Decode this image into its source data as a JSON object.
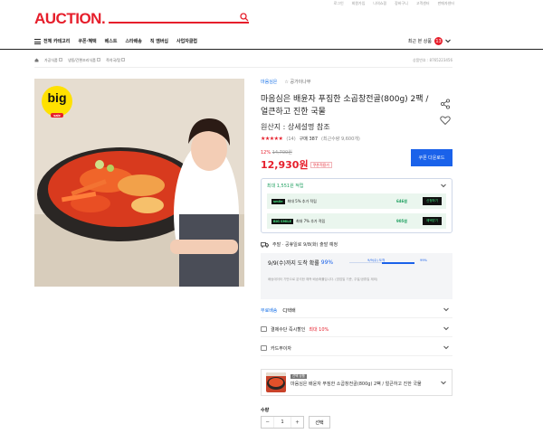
{
  "util": [
    "로그인",
    "회원가입",
    "나의쇼핑",
    "장바구니",
    "고객센터",
    "판매자센터"
  ],
  "logo": "AUCTION.",
  "search": {
    "placeholder": ""
  },
  "nav": {
    "all_category": "전체 카테고리",
    "items": [
      "쿠폰·혜택",
      "베스트",
      "스타배송",
      "직 멤버십",
      "사업자클럽"
    ],
    "recent": "최근 본 상품",
    "recent_count": "13"
  },
  "breadcrumb": [
    "가공식품",
    "냉동/간편조리식품",
    "즉석국/탕"
  ],
  "product_code": "상품번호 : 8765223456",
  "store": {
    "name": "마음심은",
    "link": "☆ 공가이나무"
  },
  "title": "마음심은 배윤자 푸짐한 소곱창전골(800g) 2팩 / 얼큰하고 진한 국물",
  "origin": "원산지 : 상세설명 참조",
  "rating": {
    "stars": "★★★★★",
    "count": "(14)",
    "sold": "구매 387",
    "note": "(최근수량 9,600개)"
  },
  "price": {
    "discount_pct": "12%",
    "original": "14,700원",
    "sale": "12,930원",
    "coupon_tag": "쿠폰적용가",
    "coupon_btn": "쿠폰 다운로드"
  },
  "points": {
    "head": "최대 1,551원 적립",
    "rows": [
      {
        "logo": "smile",
        "text": "최대 5% 추가 적립",
        "amount": "646원",
        "btn": "신청하기"
      },
      {
        "logo": "BIG SMILE",
        "text": "최대 7% 추가 적립",
        "amount": "905원",
        "btn": "혜택받기"
      }
    ]
  },
  "shipping": {
    "line": "주말 · 공휴일로 9/8(화) 출발 예정",
    "arrival": "9/9(수)까지 도착 확률",
    "arrival_pct": "99%",
    "arrival_pct_value": 99,
    "bar_label1": "9/9(수) 도착",
    "bar_label2": "99%",
    "note": "배송데이터 기반으로 분석한 예측 배송확률입니다. (영업일 기준, 주말/공휴일 제외)"
  },
  "options": [
    {
      "blue": "무료배송",
      "text": "CJ택배",
      "red": ""
    },
    {
      "blue": "",
      "text": "결제수단 즉시할인",
      "red": "최대 10%"
    },
    {
      "blue": "",
      "text": "카드무이자",
      "red": ""
    }
  ],
  "selected_product": {
    "tag": "선택 상품",
    "name": "마음심은 배윤자 푸짐한 소곱창전골(800g) 2팩 / 얼큰하고 진한 국물"
  },
  "quantity": {
    "label": "수량",
    "value": "1",
    "minus": "−",
    "plus": "+",
    "choose": "선택"
  },
  "promo": {
    "big": "big",
    "sale": "sale"
  }
}
